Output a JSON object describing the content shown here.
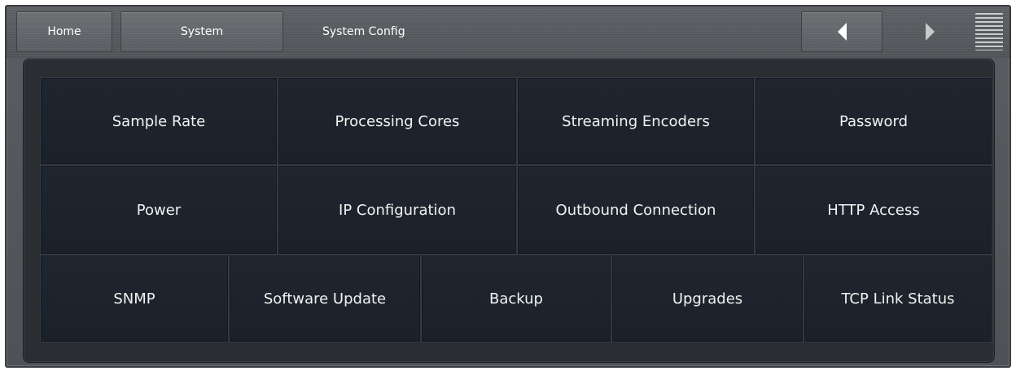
{
  "topbar": {
    "home_label": "Home",
    "system_label": "System",
    "breadcrumb": "System Config",
    "icons": {
      "back": "left-arrow-icon",
      "forward": "right-arrow-icon",
      "menu": "menu-lines-icon"
    }
  },
  "grid": {
    "row1": [
      "Sample Rate",
      "Processing Cores",
      "Streaming Encoders",
      "Password"
    ],
    "row2": [
      "Power",
      "IP Configuration",
      "Outbound Connection",
      "HTTP Access"
    ],
    "row3": [
      "SNMP",
      "Software Update",
      "Backup",
      "Upgrades",
      "TCP Link Status"
    ]
  },
  "colors": {
    "frame": "#55585c",
    "panel": "#2a2d31",
    "tile": "#1d232c",
    "text": "#f2f2f2"
  }
}
